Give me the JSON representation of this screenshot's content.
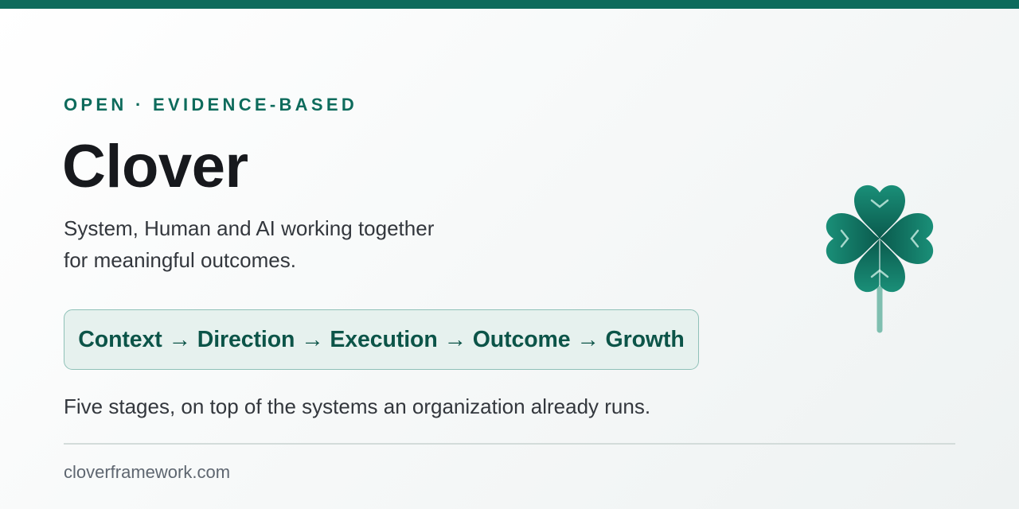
{
  "header": {
    "eyebrow": "OPEN · EVIDENCE-BASED",
    "title": "Clover",
    "subtitle_line1": "System, Human and AI working together",
    "subtitle_line2": "for meaningful outcomes."
  },
  "flow": {
    "text": "Context → Direction → Execution → Outcome → Growth"
  },
  "caption": "Five stages, on top of the systems an organization already runs.",
  "footer": {
    "url": "cloverframework.com"
  },
  "colors": {
    "accent": "#0e6b5c",
    "accent_dark": "#0c5448",
    "flow_bg": "#e6f1ee",
    "flow_border": "#8fc1b8",
    "text_dark": "#17191d",
    "text_body": "#33373d",
    "text_muted": "#5e6670"
  },
  "icons": {
    "logo": "clover-icon"
  }
}
